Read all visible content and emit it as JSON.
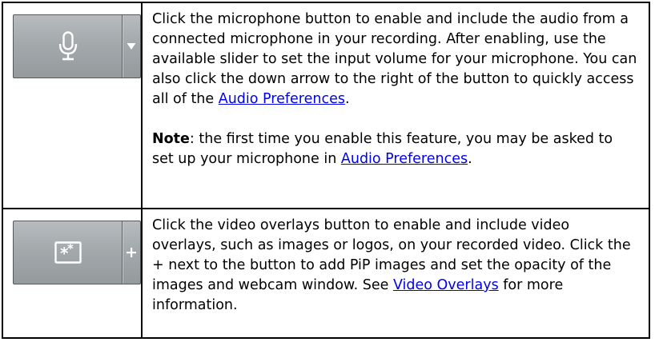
{
  "rows": [
    {
      "icon": "microphone-icon",
      "side_icon": "dropdown-arrow-icon",
      "para1_pre": "Click the microphone button to enable and include the audio from a connected microphone in your recording. After enabling, use the available slider to set the input volume for your microphone. You can also click the down arrow to the right of the button to quickly access all of the ",
      "para1_link": "Audio Preferences",
      "para1_post": ".",
      "note_label": "Note",
      "note_pre": ": the first time you enable this feature, you may be asked to set up your microphone in ",
      "note_link": "Audio Preferences",
      "note_post": "."
    },
    {
      "icon": "video-overlay-icon",
      "side_icon": "plus-icon",
      "para_pre": "Click the video overlays button to enable and include video overlays, such as images or logos, on your recorded video. Click the + next to the button to add PiP images and set the opacity of the images and webcam window. See ",
      "para_link": "Video Overlays",
      "para_post": " for more information."
    }
  ],
  "colors": {
    "link": "#0000ee",
    "button_gradient_top": "#b8bcbf",
    "button_gradient_bottom": "#959a9d",
    "icon_fill": "#ffffff"
  }
}
